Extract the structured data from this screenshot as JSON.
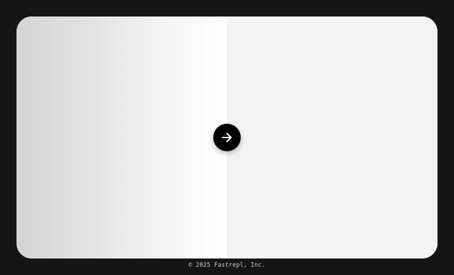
{
  "compare": {
    "next_button_icon": "arrow-right-icon"
  },
  "footer": {
    "copyright": "© 2025 Fastrepl, Inc."
  },
  "colors": {
    "page_background": "#151515",
    "button_background": "#000000",
    "button_icon": "#ffffff"
  }
}
